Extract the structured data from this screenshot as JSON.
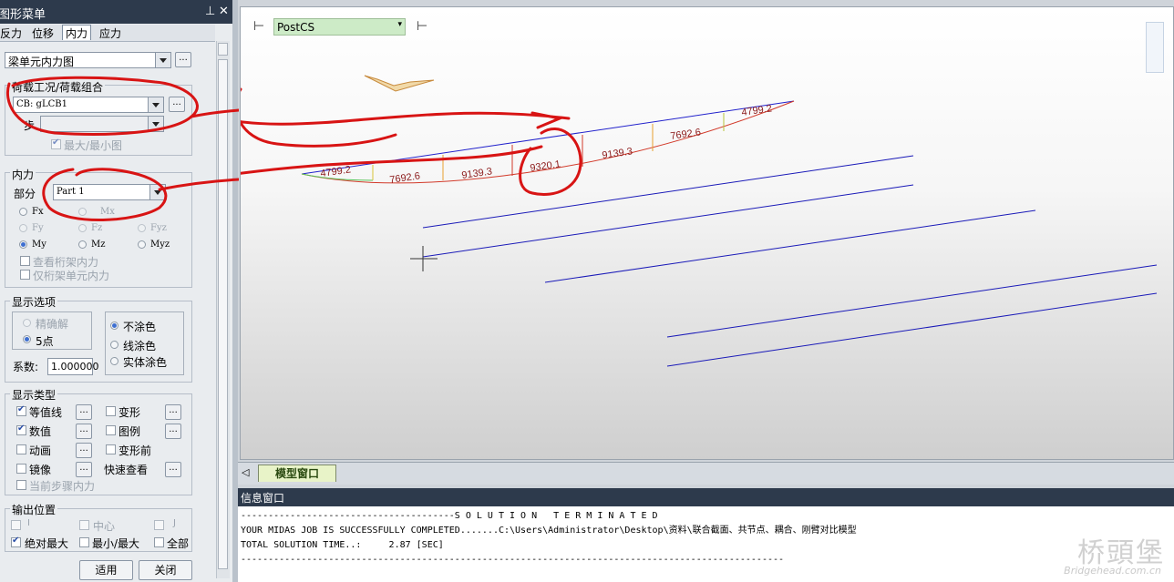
{
  "panel": {
    "title": "图形菜单",
    "pin_icon": "pin-icon",
    "close_icon": "close-icon",
    "tabs": [
      "反力",
      "位移",
      "内力",
      "应力"
    ],
    "active_tab": "内力",
    "diagram_type": "梁单元内力图",
    "load_case": {
      "label": "荷载工况/荷载组合",
      "value": "CB: gLCB1",
      "step_label": "步",
      "step_value": "",
      "maxmin_label": "最大/最小图"
    },
    "force": {
      "label": "内力",
      "part_label": "部分",
      "part_value": "Part 1",
      "components": [
        {
          "label": "Fx",
          "enabled": true,
          "selected": false
        },
        {
          "label": "Mx",
          "enabled": false,
          "selected": false
        },
        {
          "label": "Fy",
          "enabled": false,
          "selected": false
        },
        {
          "label": "Fz",
          "enabled": false,
          "selected": false
        },
        {
          "label": "Fyz",
          "enabled": false,
          "selected": false
        },
        {
          "label": "My",
          "enabled": true,
          "selected": true
        },
        {
          "label": "Mz",
          "enabled": true,
          "selected": false
        },
        {
          "label": "Myz",
          "enabled": true,
          "selected": false
        }
      ],
      "truss_label": "查看桁架内力",
      "frame_only_label": "仅桁架单元内力"
    },
    "display": {
      "label": "显示选项",
      "exact_label": "精确解",
      "points_label": "5点",
      "no_fill_label": "不涂色",
      "line_fill_label": "线涂色",
      "solid_fill_label": "实体涂色",
      "coef_label": "系数:",
      "coef_value": "1.000000"
    },
    "display_type": {
      "label": "显示类型",
      "contour_label": "等值线",
      "deform_label": "变形",
      "values_label": "数值",
      "legend_label": "图例",
      "animation_label": "动画",
      "before_deform_label": "变形前",
      "mirror_label": "镜像",
      "quick_view_label": "快速查看",
      "current_step_label": "当前步骤内力"
    },
    "output": {
      "label": "输出位置",
      "i_label": "I",
      "center_label": "中心",
      "j_label": "J",
      "abs_max_label": "绝对最大",
      "minmax_label": "最小/最大",
      "all_label": "全部"
    },
    "apply_label": "适用",
    "close_label": "关闭"
  },
  "view": {
    "coord_system": "PostCS",
    "moment_labels": [
      "4799.2",
      "7692.6",
      "9139.3",
      "9320.1",
      "9139.3",
      "7692.6",
      "4799.2"
    ],
    "tab_label": "模型窗口"
  },
  "info": {
    "title": "信息窗口",
    "lines": [
      "---------------------------------------S O L U T I O N   T E R M I N A T E D",
      "YOUR MIDAS JOB IS SUCCESSFULLY COMPLETED.......C:\\Users\\Administrator\\Desktop\\资料\\联合截面、共节点、耦合、刚臂对比模型",
      "TOTAL SOLUTION TIME..:     2.87 [SEC]",
      "---------------------------------------------------------------------------------------------------"
    ]
  },
  "watermark": {
    "text": "桥頭堡",
    "sub": "Bridgehead.com.cn"
  }
}
